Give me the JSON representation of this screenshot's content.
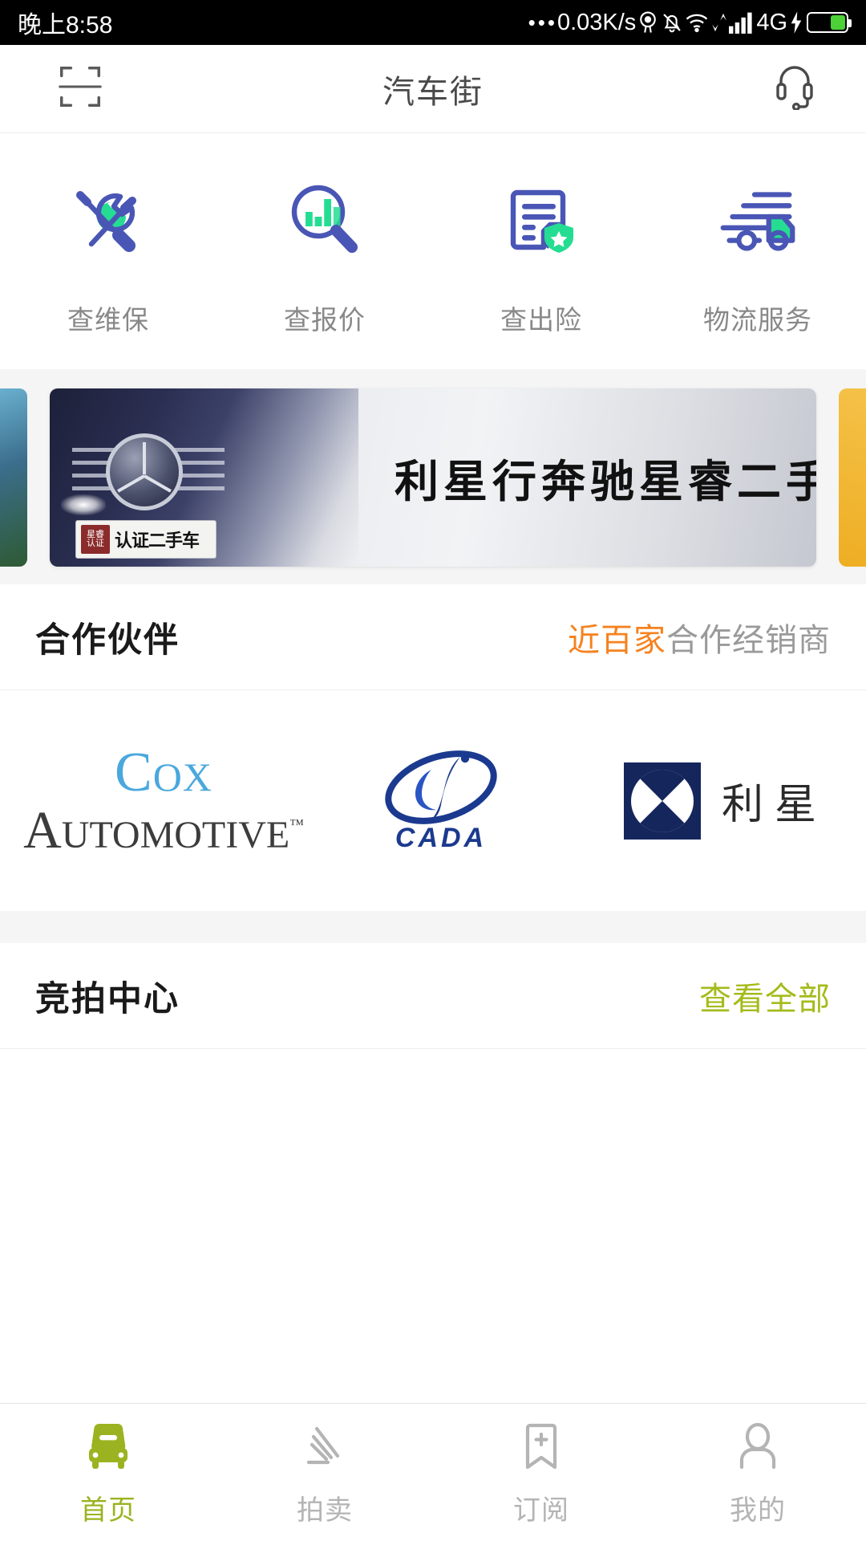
{
  "statusbar": {
    "time": "晚上8:58",
    "dots": "•••",
    "netspeed": "0.03K/s",
    "network": "4G",
    "icons": [
      "location-icon",
      "mute-bell-icon",
      "wifi-icon",
      "data-transfer-icon",
      "signal-bars-icon",
      "charging-bolt-icon",
      "battery-icon"
    ]
  },
  "header": {
    "title": "汽车街",
    "scan_icon": "scan-frame-icon",
    "support_icon": "headset-icon"
  },
  "quick_entries": [
    {
      "label": "查维保",
      "icon": "tools-wrench-screwdriver-icon"
    },
    {
      "label": "查报价",
      "icon": "magnifier-bar-chart-icon"
    },
    {
      "label": "查出险",
      "icon": "document-shield-star-icon"
    },
    {
      "label": "物流服务",
      "icon": "delivery-truck-icon"
    }
  ],
  "banner": {
    "title": "利星行奔驰星睿二手车",
    "plate_badge": "星睿\n认证",
    "plate_text": "认证二手车"
  },
  "partner_section": {
    "title": "合作伙伴",
    "more_highlight": "近百家",
    "more_rest": "合作经销商"
  },
  "partners": [
    {
      "name": "cox-automotive-logo",
      "line1": "Cox",
      "line2": "Automotive",
      "tm": "™"
    },
    {
      "name": "cada-logo",
      "text": "CADA"
    },
    {
      "name": "lixinghang-logo",
      "text": "利星"
    }
  ],
  "auction_section": {
    "title": "竞拍中心",
    "more": "查看全部"
  },
  "tabbar": [
    {
      "label": "首页",
      "icon": "car-icon",
      "active": true
    },
    {
      "label": "拍卖",
      "icon": "gavel-icon",
      "active": false
    },
    {
      "label": "订阅",
      "icon": "bookmark-plus-icon",
      "active": false
    },
    {
      "label": "我的",
      "icon": "person-icon",
      "active": false
    }
  ],
  "colors": {
    "accent_green": "#9bb320",
    "icon_blue": "#4a56b5",
    "icon_green": "#25dd92",
    "orange": "#f5821f",
    "status_battery": "#4cd137"
  }
}
